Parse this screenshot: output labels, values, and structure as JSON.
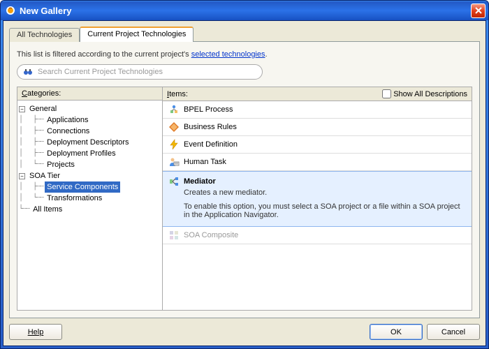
{
  "title": "New Gallery",
  "tabs": {
    "all": "All Technologies",
    "current": "Current Project Technologies"
  },
  "filter_prefix": "This list is filtered according to the current project's ",
  "filter_link": "selected technologies",
  "filter_suffix": ".",
  "search_placeholder": "Search Current Project Technologies",
  "categories_label": "Categories:",
  "items_label": "Items:",
  "show_all_label": "Show All Descriptions",
  "tree": {
    "general": "General",
    "applications": "Applications",
    "connections": "Connections",
    "deployment_descriptors": "Deployment Descriptors",
    "deployment_profiles": "Deployment Profiles",
    "projects": "Projects",
    "soa_tier": "SOA Tier",
    "service_components": "Service Components",
    "transformations": "Transformations",
    "all_items": "All Items"
  },
  "items": {
    "bpel": "BPEL Process",
    "rules": "Business Rules",
    "event": "Event Definition",
    "human": "Human Task",
    "mediator": "Mediator",
    "mediator_desc": "Creates a new mediator.",
    "mediator_note": "To enable this option, you must select a SOA project or a file within a SOA project in the Application Navigator.",
    "composite": "SOA Composite"
  },
  "buttons": {
    "help": "Help",
    "ok": "OK",
    "cancel": "Cancel"
  }
}
